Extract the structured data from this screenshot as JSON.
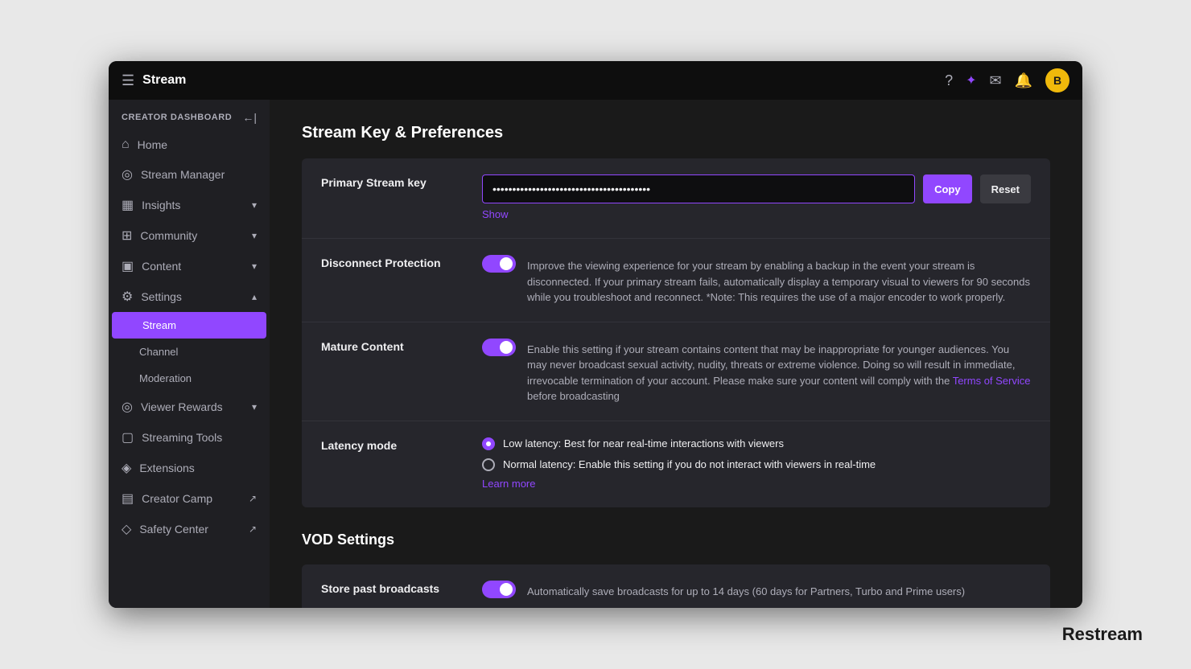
{
  "window": {
    "title": "Stream",
    "hamburger_label": "☰"
  },
  "titlebar": {
    "title": "Stream",
    "icons": {
      "help": "?",
      "magic": "✦",
      "mail": "✉",
      "bell": "🔔",
      "avatar_label": "B"
    }
  },
  "sidebar": {
    "dashboard_label": "CREATOR DASHBOARD",
    "items": [
      {
        "id": "home",
        "label": "Home",
        "icon": "⌂",
        "has_chevron": false
      },
      {
        "id": "stream-manager",
        "label": "Stream Manager",
        "icon": "◎",
        "has_chevron": false
      },
      {
        "id": "insights",
        "label": "Insights",
        "icon": "▦",
        "has_chevron": true
      },
      {
        "id": "community",
        "label": "Community",
        "icon": "⊞",
        "has_chevron": true
      },
      {
        "id": "content",
        "label": "Content",
        "icon": "▣",
        "has_chevron": true
      },
      {
        "id": "settings",
        "label": "Settings",
        "icon": "⚙",
        "has_chevron": true,
        "expanded": true
      }
    ],
    "sub_items": [
      {
        "id": "stream",
        "label": "Stream",
        "active": true
      },
      {
        "id": "channel",
        "label": "Channel",
        "active": false
      },
      {
        "id": "moderation",
        "label": "Moderation",
        "active": false
      }
    ],
    "bottom_items": [
      {
        "id": "viewer-rewards",
        "label": "Viewer Rewards",
        "icon": "◎",
        "has_chevron": true
      },
      {
        "id": "streaming-tools",
        "label": "Streaming Tools",
        "icon": "▢",
        "has_chevron": false
      },
      {
        "id": "extensions",
        "label": "Extensions",
        "icon": "◈",
        "has_chevron": false
      },
      {
        "id": "creator-camp",
        "label": "Creator Camp",
        "icon": "▤",
        "has_ext": true
      },
      {
        "id": "safety-center",
        "label": "Safety Center",
        "icon": "◇",
        "has_ext": true
      }
    ]
  },
  "main": {
    "page_title": "Stream Key & Preferences",
    "stream_key_section": {
      "label": "Primary Stream key",
      "placeholder": "••••••••••••••••••••••••••••••••••••••••",
      "copy_btn": "Copy",
      "reset_btn": "Reset",
      "show_link": "Show"
    },
    "disconnect_protection": {
      "label": "Disconnect Protection",
      "toggle_on": true,
      "description": "Improve the viewing experience for your stream by enabling a backup in the event your stream is disconnected. If your primary stream fails, automatically display a temporary visual to viewers for 90 seconds while you troubleshoot and reconnect. *Note: This requires the use of a major encoder to work properly."
    },
    "mature_content": {
      "label": "Mature Content",
      "toggle_on": true,
      "description_before": "Enable this setting if your stream contains content that may be inappropriate for younger audiences. You may never broadcast sexual activity, nudity, threats or extreme violence. Doing so will result in immediate, irrevocable termination of your account. Please make sure your content will comply with the ",
      "terms_link": "Terms of Service",
      "description_after": " before broadcasting"
    },
    "latency_mode": {
      "label": "Latency mode",
      "options": [
        {
          "id": "low",
          "label": "Low latency: Best for near real-time interactions with viewers",
          "selected": true
        },
        {
          "id": "normal",
          "label": "Normal latency: Enable this setting if you do not interact with viewers in real-time",
          "selected": false
        }
      ],
      "learn_more_link": "Learn more"
    },
    "vod_section_title": "VOD Settings",
    "store_past_broadcasts": {
      "label": "Store past broadcasts",
      "toggle_on": true,
      "description": "Automatically save broadcasts for up to 14 days (60 days for Partners, Turbo and Prime users)"
    }
  },
  "watermark": "Restream"
}
